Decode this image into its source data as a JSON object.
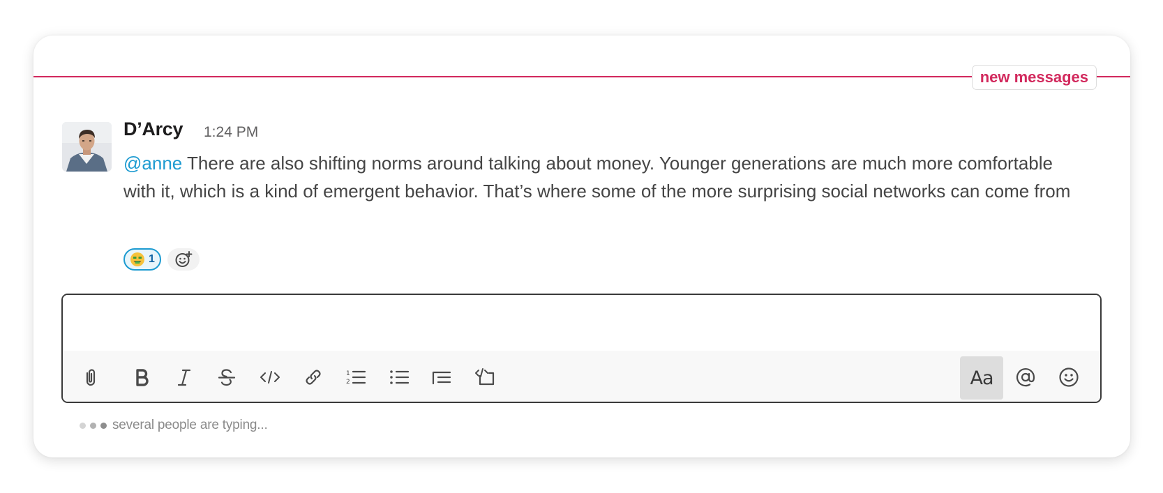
{
  "divider": {
    "label": "new messages",
    "color": "#d2295d"
  },
  "message": {
    "author": "D’Arcy",
    "time": "1:24 PM",
    "mention": "@anne",
    "text": " There are also shifting norms around talking about money. Younger generations are much more comfortable with it, which is a kind of emergent behavior. That’s where some of the more surprising social networks can come from",
    "reactions": [
      {
        "emoji": "money-mouth-face",
        "count": "1"
      }
    ]
  },
  "composer": {
    "placeholder": "",
    "value": "",
    "toolbar": [
      "attach-icon",
      "bold-icon",
      "italic-icon",
      "strikethrough-icon",
      "code-icon",
      "link-icon",
      "ordered-list-icon",
      "bulleted-list-icon",
      "blockquote-icon",
      "code-block-icon"
    ],
    "right_toolbar": {
      "format_label": "Aa",
      "mention_icon": "at-icon",
      "emoji_icon": "emoji-icon"
    }
  },
  "typing": {
    "text": "several people are typing..."
  },
  "colors": {
    "accent": "#d2295d",
    "mention": "#1d9bd1",
    "reaction_border": "#1d9bd1"
  }
}
